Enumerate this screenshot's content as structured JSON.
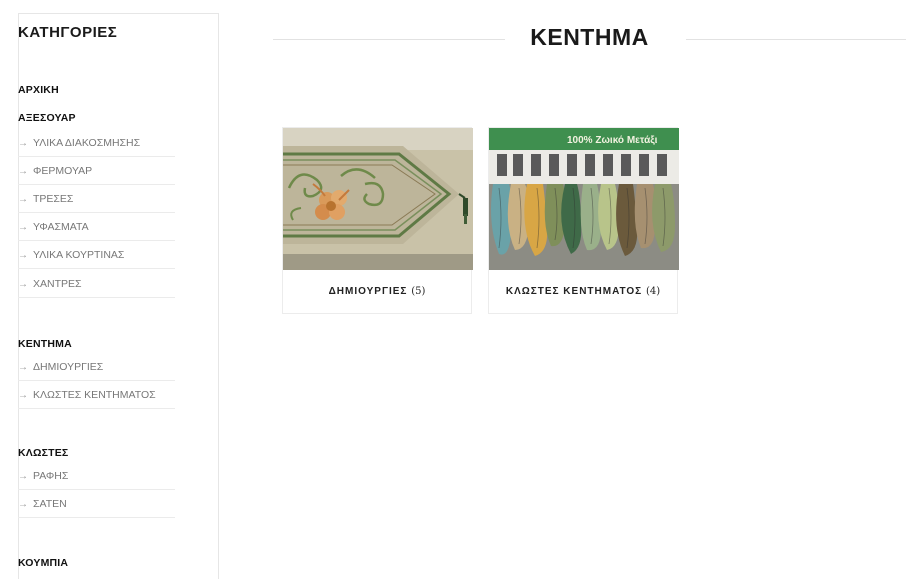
{
  "sidebar": {
    "title": "ΚΑΤΗΓΟΡΙΕΣ",
    "arrow_glyph": "→",
    "home": "ΑΡΧΙΚΗ",
    "groups": [
      {
        "title": "ΑΞΕΣΟΥΑΡ",
        "items": [
          "ΥΛΙΚΑ ΔΙΑΚΟΣΜΗΣΗΣ",
          "ΦΕΡΜΟΥΑΡ",
          "ΤΡΕΣΕΣ",
          "ΥΦΑΣΜΑΤΑ",
          "ΥΛΙΚΑ ΚΟΥΡΤΙΝΑΣ",
          "ΧΑΝΤΡΕΣ"
        ]
      },
      {
        "title": "ΚΕΝΤΗΜΑ",
        "items": [
          "ΔΗΜΙΟΥΡΓΙΕΣ",
          "ΚΛΩΣΤΕΣ ΚΕΝΤΗΜΑΤΟΣ"
        ]
      },
      {
        "title": "ΚΛΩΣΤΕΣ",
        "items": [
          "ΡΑΦΗΣ",
          "ΣΑΤΕΝ"
        ]
      },
      {
        "title": "ΚΟΥΜΠΙΑ",
        "items": []
      }
    ]
  },
  "main": {
    "heading": "ΚΕΝΤΗΜΑ",
    "cards": [
      {
        "label": "ΔΗΜΙΟΥΡΓΙΕΣ",
        "count": "(5)"
      },
      {
        "label": "ΚΛΩΣΤΕΣ ΚΕΝΤΗΜΑΤΟΣ",
        "count": "(4)",
        "image_text": "100% Ζωικό Μετάξι"
      }
    ]
  },
  "colors": {
    "linen": "#bdb59a",
    "embroidery_green": "#5f7a45",
    "flower_orange": "#d99a5a",
    "label_band_green": "#3f8f4f"
  }
}
